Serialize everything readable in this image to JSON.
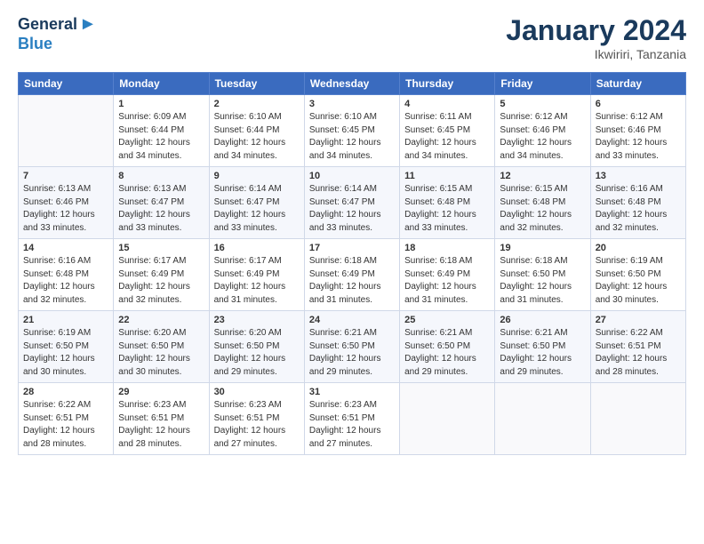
{
  "logo": {
    "general": "General",
    "blue": "Blue"
  },
  "title": "January 2024",
  "location": "Ikwiriri, Tanzania",
  "days_header": [
    "Sunday",
    "Monday",
    "Tuesday",
    "Wednesday",
    "Thursday",
    "Friday",
    "Saturday"
  ],
  "weeks": [
    [
      {
        "num": "",
        "info": ""
      },
      {
        "num": "1",
        "info": "Sunrise: 6:09 AM\nSunset: 6:44 PM\nDaylight: 12 hours\nand 34 minutes."
      },
      {
        "num": "2",
        "info": "Sunrise: 6:10 AM\nSunset: 6:44 PM\nDaylight: 12 hours\nand 34 minutes."
      },
      {
        "num": "3",
        "info": "Sunrise: 6:10 AM\nSunset: 6:45 PM\nDaylight: 12 hours\nand 34 minutes."
      },
      {
        "num": "4",
        "info": "Sunrise: 6:11 AM\nSunset: 6:45 PM\nDaylight: 12 hours\nand 34 minutes."
      },
      {
        "num": "5",
        "info": "Sunrise: 6:12 AM\nSunset: 6:46 PM\nDaylight: 12 hours\nand 34 minutes."
      },
      {
        "num": "6",
        "info": "Sunrise: 6:12 AM\nSunset: 6:46 PM\nDaylight: 12 hours\nand 33 minutes."
      }
    ],
    [
      {
        "num": "7",
        "info": "Sunrise: 6:13 AM\nSunset: 6:46 PM\nDaylight: 12 hours\nand 33 minutes."
      },
      {
        "num": "8",
        "info": "Sunrise: 6:13 AM\nSunset: 6:47 PM\nDaylight: 12 hours\nand 33 minutes."
      },
      {
        "num": "9",
        "info": "Sunrise: 6:14 AM\nSunset: 6:47 PM\nDaylight: 12 hours\nand 33 minutes."
      },
      {
        "num": "10",
        "info": "Sunrise: 6:14 AM\nSunset: 6:47 PM\nDaylight: 12 hours\nand 33 minutes."
      },
      {
        "num": "11",
        "info": "Sunrise: 6:15 AM\nSunset: 6:48 PM\nDaylight: 12 hours\nand 33 minutes."
      },
      {
        "num": "12",
        "info": "Sunrise: 6:15 AM\nSunset: 6:48 PM\nDaylight: 12 hours\nand 32 minutes."
      },
      {
        "num": "13",
        "info": "Sunrise: 6:16 AM\nSunset: 6:48 PM\nDaylight: 12 hours\nand 32 minutes."
      }
    ],
    [
      {
        "num": "14",
        "info": "Sunrise: 6:16 AM\nSunset: 6:48 PM\nDaylight: 12 hours\nand 32 minutes."
      },
      {
        "num": "15",
        "info": "Sunrise: 6:17 AM\nSunset: 6:49 PM\nDaylight: 12 hours\nand 32 minutes."
      },
      {
        "num": "16",
        "info": "Sunrise: 6:17 AM\nSunset: 6:49 PM\nDaylight: 12 hours\nand 31 minutes."
      },
      {
        "num": "17",
        "info": "Sunrise: 6:18 AM\nSunset: 6:49 PM\nDaylight: 12 hours\nand 31 minutes."
      },
      {
        "num": "18",
        "info": "Sunrise: 6:18 AM\nSunset: 6:49 PM\nDaylight: 12 hours\nand 31 minutes."
      },
      {
        "num": "19",
        "info": "Sunrise: 6:18 AM\nSunset: 6:50 PM\nDaylight: 12 hours\nand 31 minutes."
      },
      {
        "num": "20",
        "info": "Sunrise: 6:19 AM\nSunset: 6:50 PM\nDaylight: 12 hours\nand 30 minutes."
      }
    ],
    [
      {
        "num": "21",
        "info": "Sunrise: 6:19 AM\nSunset: 6:50 PM\nDaylight: 12 hours\nand 30 minutes."
      },
      {
        "num": "22",
        "info": "Sunrise: 6:20 AM\nSunset: 6:50 PM\nDaylight: 12 hours\nand 30 minutes."
      },
      {
        "num": "23",
        "info": "Sunrise: 6:20 AM\nSunset: 6:50 PM\nDaylight: 12 hours\nand 29 minutes."
      },
      {
        "num": "24",
        "info": "Sunrise: 6:21 AM\nSunset: 6:50 PM\nDaylight: 12 hours\nand 29 minutes."
      },
      {
        "num": "25",
        "info": "Sunrise: 6:21 AM\nSunset: 6:50 PM\nDaylight: 12 hours\nand 29 minutes."
      },
      {
        "num": "26",
        "info": "Sunrise: 6:21 AM\nSunset: 6:50 PM\nDaylight: 12 hours\nand 29 minutes."
      },
      {
        "num": "27",
        "info": "Sunrise: 6:22 AM\nSunset: 6:51 PM\nDaylight: 12 hours\nand 28 minutes."
      }
    ],
    [
      {
        "num": "28",
        "info": "Sunrise: 6:22 AM\nSunset: 6:51 PM\nDaylight: 12 hours\nand 28 minutes."
      },
      {
        "num": "29",
        "info": "Sunrise: 6:23 AM\nSunset: 6:51 PM\nDaylight: 12 hours\nand 28 minutes."
      },
      {
        "num": "30",
        "info": "Sunrise: 6:23 AM\nSunset: 6:51 PM\nDaylight: 12 hours\nand 27 minutes."
      },
      {
        "num": "31",
        "info": "Sunrise: 6:23 AM\nSunset: 6:51 PM\nDaylight: 12 hours\nand 27 minutes."
      },
      {
        "num": "",
        "info": ""
      },
      {
        "num": "",
        "info": ""
      },
      {
        "num": "",
        "info": ""
      }
    ]
  ]
}
